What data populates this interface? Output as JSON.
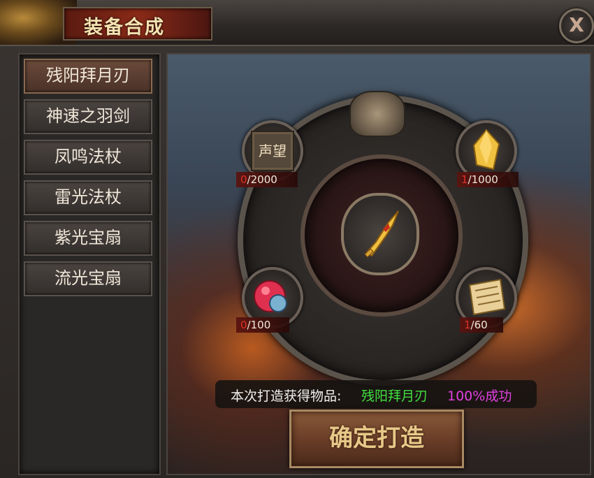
{
  "window": {
    "title": "装备合成"
  },
  "close_button": {
    "icon": "close-icon",
    "label": "X"
  },
  "recipe_list": {
    "items": [
      {
        "label": "残阳拜月刃",
        "active": true
      },
      {
        "label": "神速之羽剑",
        "active": false
      },
      {
        "label": "凤鸣法杖",
        "active": false
      },
      {
        "label": "雷光法杖",
        "active": false
      },
      {
        "label": "紫光宝扇",
        "active": false
      },
      {
        "label": "流光宝扇",
        "active": false
      }
    ]
  },
  "materials": {
    "reputation": {
      "icon_text": "声望",
      "owned": "0",
      "required": "/2000"
    },
    "gold_crystal": {
      "icon": "gold-crystal-icon",
      "owned": "1",
      "required": "/1000"
    },
    "red_orb": {
      "icon": "red-orb-icon",
      "owned": "0",
      "required": "/100"
    },
    "scroll": {
      "icon": "scroll-icon",
      "owned": "1",
      "required": "/60"
    }
  },
  "result": {
    "icon": "golden-blade-icon",
    "label": "本次打造获得物品:",
    "item_name": "残阳拜月刃",
    "success_rate": "100%成功"
  },
  "forge_button": {
    "label": "确定打造"
  },
  "colors": {
    "item_name": "#40e040",
    "success_rate": "#e040e0",
    "count_zero": "#e03028",
    "title_text": "#f4e2b0"
  }
}
